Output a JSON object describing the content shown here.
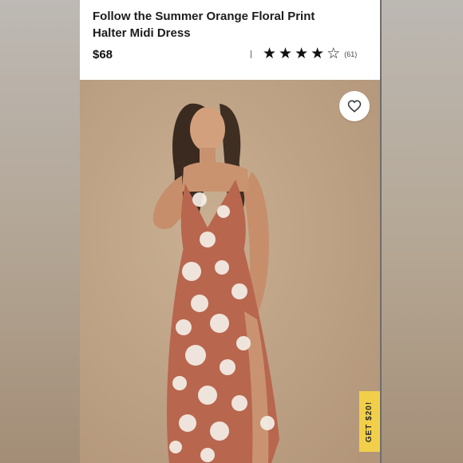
{
  "product": {
    "title_line1": "Follow the Summer Orange Floral Print",
    "title_line2": "Halter Midi Dress",
    "price": "$68",
    "rating": {
      "filled_stars": 4,
      "total_stars": 5,
      "review_count": "(61)"
    }
  },
  "image": {
    "description_icon": "photo-model-dress",
    "favorite_icon": "heart-icon"
  },
  "promo": {
    "label": "GET $20!"
  },
  "colors": {
    "dress": "#b8664e",
    "background_photo": "#bfa385",
    "promo_tab": "#f2cf4a"
  }
}
